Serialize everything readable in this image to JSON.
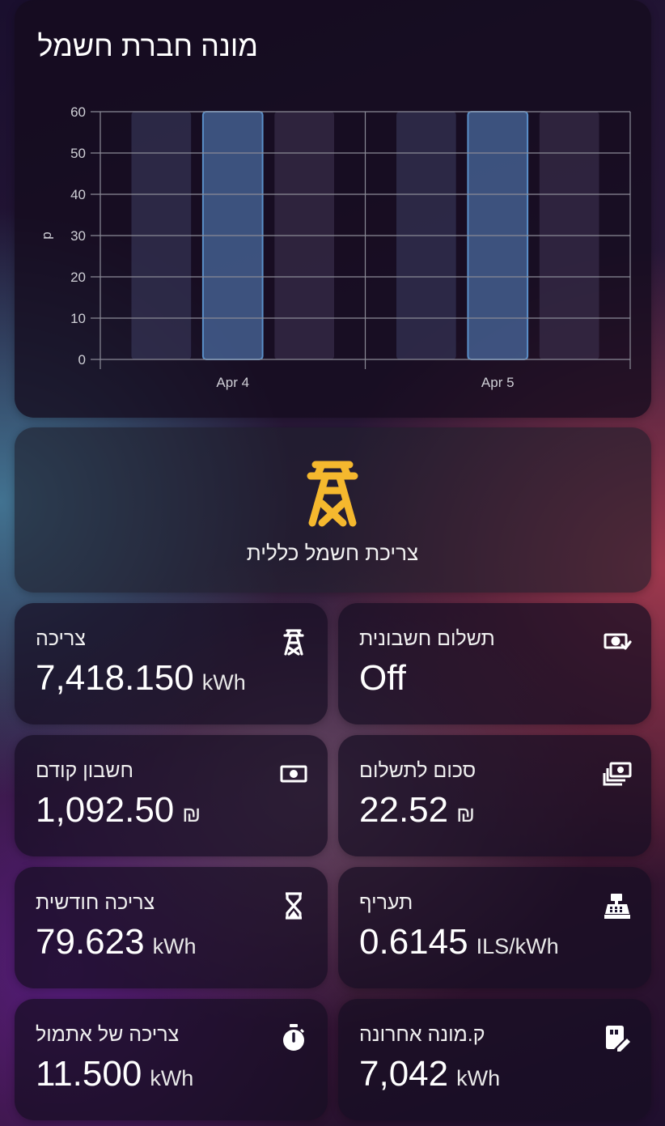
{
  "chart_card": {
    "title": "מונה חברת חשמל"
  },
  "chart_data": {
    "type": "bar",
    "categories": [
      "Apr 4",
      "Apr 5"
    ],
    "series": [
      {
        "values": [
          60,
          60
        ]
      },
      {
        "values": [
          60,
          60
        ]
      },
      {
        "values": [
          60,
          60
        ]
      }
    ],
    "xlabel": "",
    "ylabel": "d",
    "ylim": [
      0,
      60
    ],
    "yticks": [
      0,
      10,
      20,
      30,
      40,
      50,
      60
    ],
    "grid": true,
    "colors": [
      "#3a3a5e",
      "#4a6a9e",
      "#3e3250"
    ]
  },
  "total_card": {
    "label": "צריכת חשמל כללית",
    "icon": "transmission-tower-icon",
    "icon_color": "#f5b82e"
  },
  "tiles": [
    {
      "label": "צריכה",
      "value": "7,418.150",
      "unit": "kWh",
      "icon": "transmission-tower-icon"
    },
    {
      "label": "תשלום חשבונית",
      "value": "Off",
      "unit": "",
      "icon": "cash-check-icon"
    },
    {
      "label": "חשבון קודם",
      "value": "1,092.50",
      "unit": "₪",
      "icon": "cash-icon"
    },
    {
      "label": "סכום לתשלום",
      "value": "22.52",
      "unit": "₪",
      "icon": "cash-multiple-icon"
    },
    {
      "label": "צריכה חודשית",
      "value": "79.623",
      "unit": "kWh",
      "icon": "hourglass-icon"
    },
    {
      "label": "תעריף",
      "value": "0.6145",
      "unit": "ILS/kWh",
      "icon": "cash-register-icon"
    },
    {
      "label": "צריכה של אתמול",
      "value": "11.500",
      "unit": "kWh",
      "icon": "timer-icon"
    },
    {
      "label": "ק.מונה אחרונה",
      "value": "7,042",
      "unit": "kWh",
      "icon": "meter-edit-icon"
    }
  ]
}
